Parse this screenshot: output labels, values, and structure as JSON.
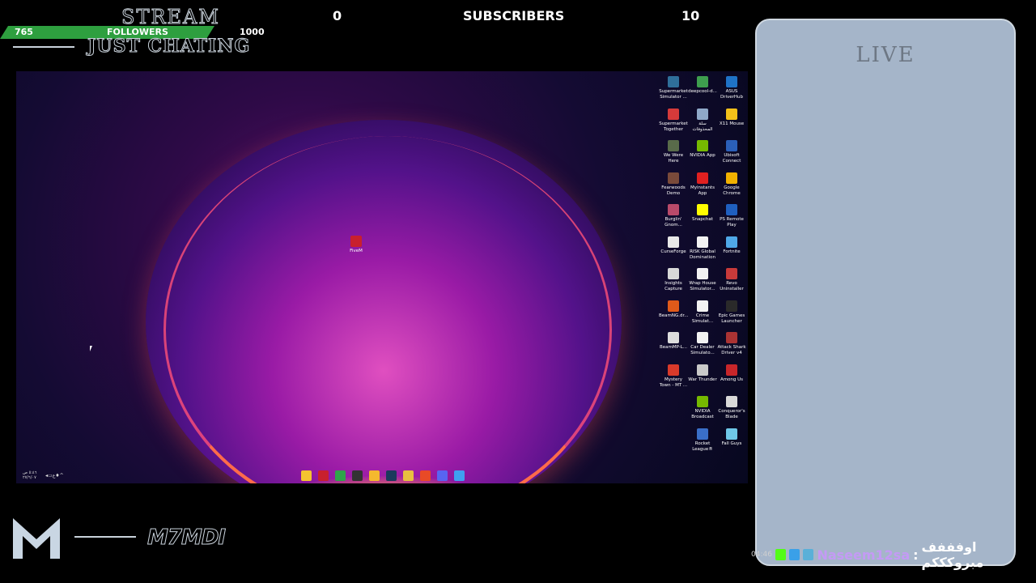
{
  "overlay": {
    "stream_title": "STREAM",
    "category": "JUST CHATING",
    "followers_goal": {
      "current": "765",
      "label": "FOLLOWERS",
      "target": "1000",
      "progress": 0.765
    },
    "subscribers": {
      "left_count": "0",
      "label": "SUBSCRIBERS",
      "right_count": "10"
    },
    "streamer_name": "M7MDI",
    "live_label": "LIVE",
    "accent_color": "#2e9f3f",
    "panel_color": "#a5b5c9"
  },
  "desktop": {
    "center_icon": {
      "name": "FiveM",
      "icon": "fivem-icon"
    },
    "icons": [
      {
        "label": "Supermarket Simulator ...",
        "color": "#2f6f9a"
      },
      {
        "label": "deepcool-d...",
        "color": "#3e9e4e"
      },
      {
        "label": "ASUS DriverHub",
        "color": "#1f73c7"
      },
      {
        "label": "Supermarket Together",
        "color": "#d63a3a"
      },
      {
        "label": "سلة المحذوفات",
        "color": "#8fa9c9"
      },
      {
        "label": "X11 Mouse",
        "color": "#f3c11a"
      },
      {
        "label": "We Were Here",
        "color": "#596b4a"
      },
      {
        "label": "NVIDIA App",
        "color": "#76b900"
      },
      {
        "label": "Ubisoft Connect",
        "color": "#2b5fb8"
      },
      {
        "label": "Fearwoods Demo",
        "color": "#7a4a3a"
      },
      {
        "label": "Myinstants App",
        "color": "#e02020"
      },
      {
        "label": "Google Chrome",
        "color": "#f1b100"
      },
      {
        "label": "Burglin' Gnom...",
        "color": "#b94a6a"
      },
      {
        "label": "Snapchat",
        "color": "#fffc00"
      },
      {
        "label": "PS Remote Play",
        "color": "#1f5fbf"
      },
      {
        "label": "CurseForge",
        "color": "#e8e8e8"
      },
      {
        "label": "RISK Global Domination",
        "color": "#f2f2f2"
      },
      {
        "label": "Fortnite",
        "color": "#4fa8e8"
      },
      {
        "label": "Insights Capture",
        "color": "#d8d8d8"
      },
      {
        "label": "Wrap House Simulator...",
        "color": "#f2f2f2"
      },
      {
        "label": "Revo Uninstaller",
        "color": "#c83a3a"
      },
      {
        "label": "BeamNG.dr...",
        "color": "#e05a1a"
      },
      {
        "label": "Crime Simulat...",
        "color": "#f2f2f2"
      },
      {
        "label": "Epic Games Launcher",
        "color": "#2a2a2a"
      },
      {
        "label": "BeamMP-L...",
        "color": "#dddddd"
      },
      {
        "label": "Car Dealer Simulato...",
        "color": "#f2f2f2"
      },
      {
        "label": "Attack Shark Driver v4",
        "color": "#a33"
      },
      {
        "label": "Mystery Town - MT ...",
        "color": "#d93a2a"
      },
      {
        "label": "War Thunder",
        "color": "#c9c9c9"
      },
      {
        "label": "Among Us",
        "color": "#c8262a"
      },
      {
        "label": "NVIDIA Broadcast",
        "color": "#76b900"
      },
      {
        "label": "Conqueror's Blade",
        "color": "#d9d9d9"
      },
      {
        "label": "Rocket League®",
        "color": "#3a6fc8"
      },
      {
        "label": "Fall Guys",
        "color": "#6fc8e8"
      }
    ],
    "taskbar": {
      "time": "٥:٤٦ ص",
      "date": "٢٧/٦/٠٧",
      "apps": [
        {
          "icon": "file-explorer-icon",
          "color": "#f4c430"
        },
        {
          "icon": "fivem-taskbar-icon",
          "color": "#c8202e"
        },
        {
          "icon": "chrome-icon",
          "color": "#2fa34a"
        },
        {
          "icon": "obs-icon",
          "color": "#333333"
        },
        {
          "icon": "snapchat-taskbar-icon",
          "color": "#f5b82e"
        },
        {
          "icon": "steam-icon",
          "color": "#1b3a5c"
        },
        {
          "icon": "folder-icon",
          "color": "#e8c040"
        },
        {
          "icon": "brave-icon",
          "color": "#e84a27"
        },
        {
          "icon": "discord-icon",
          "color": "#5865f2"
        },
        {
          "icon": "windows-icon",
          "color": "#3fa0f0"
        }
      ]
    }
  },
  "chat": {
    "time": "04:46",
    "username": "Naseem12sa",
    "separator": ":",
    "message": "اوفففف مبروكككم"
  }
}
